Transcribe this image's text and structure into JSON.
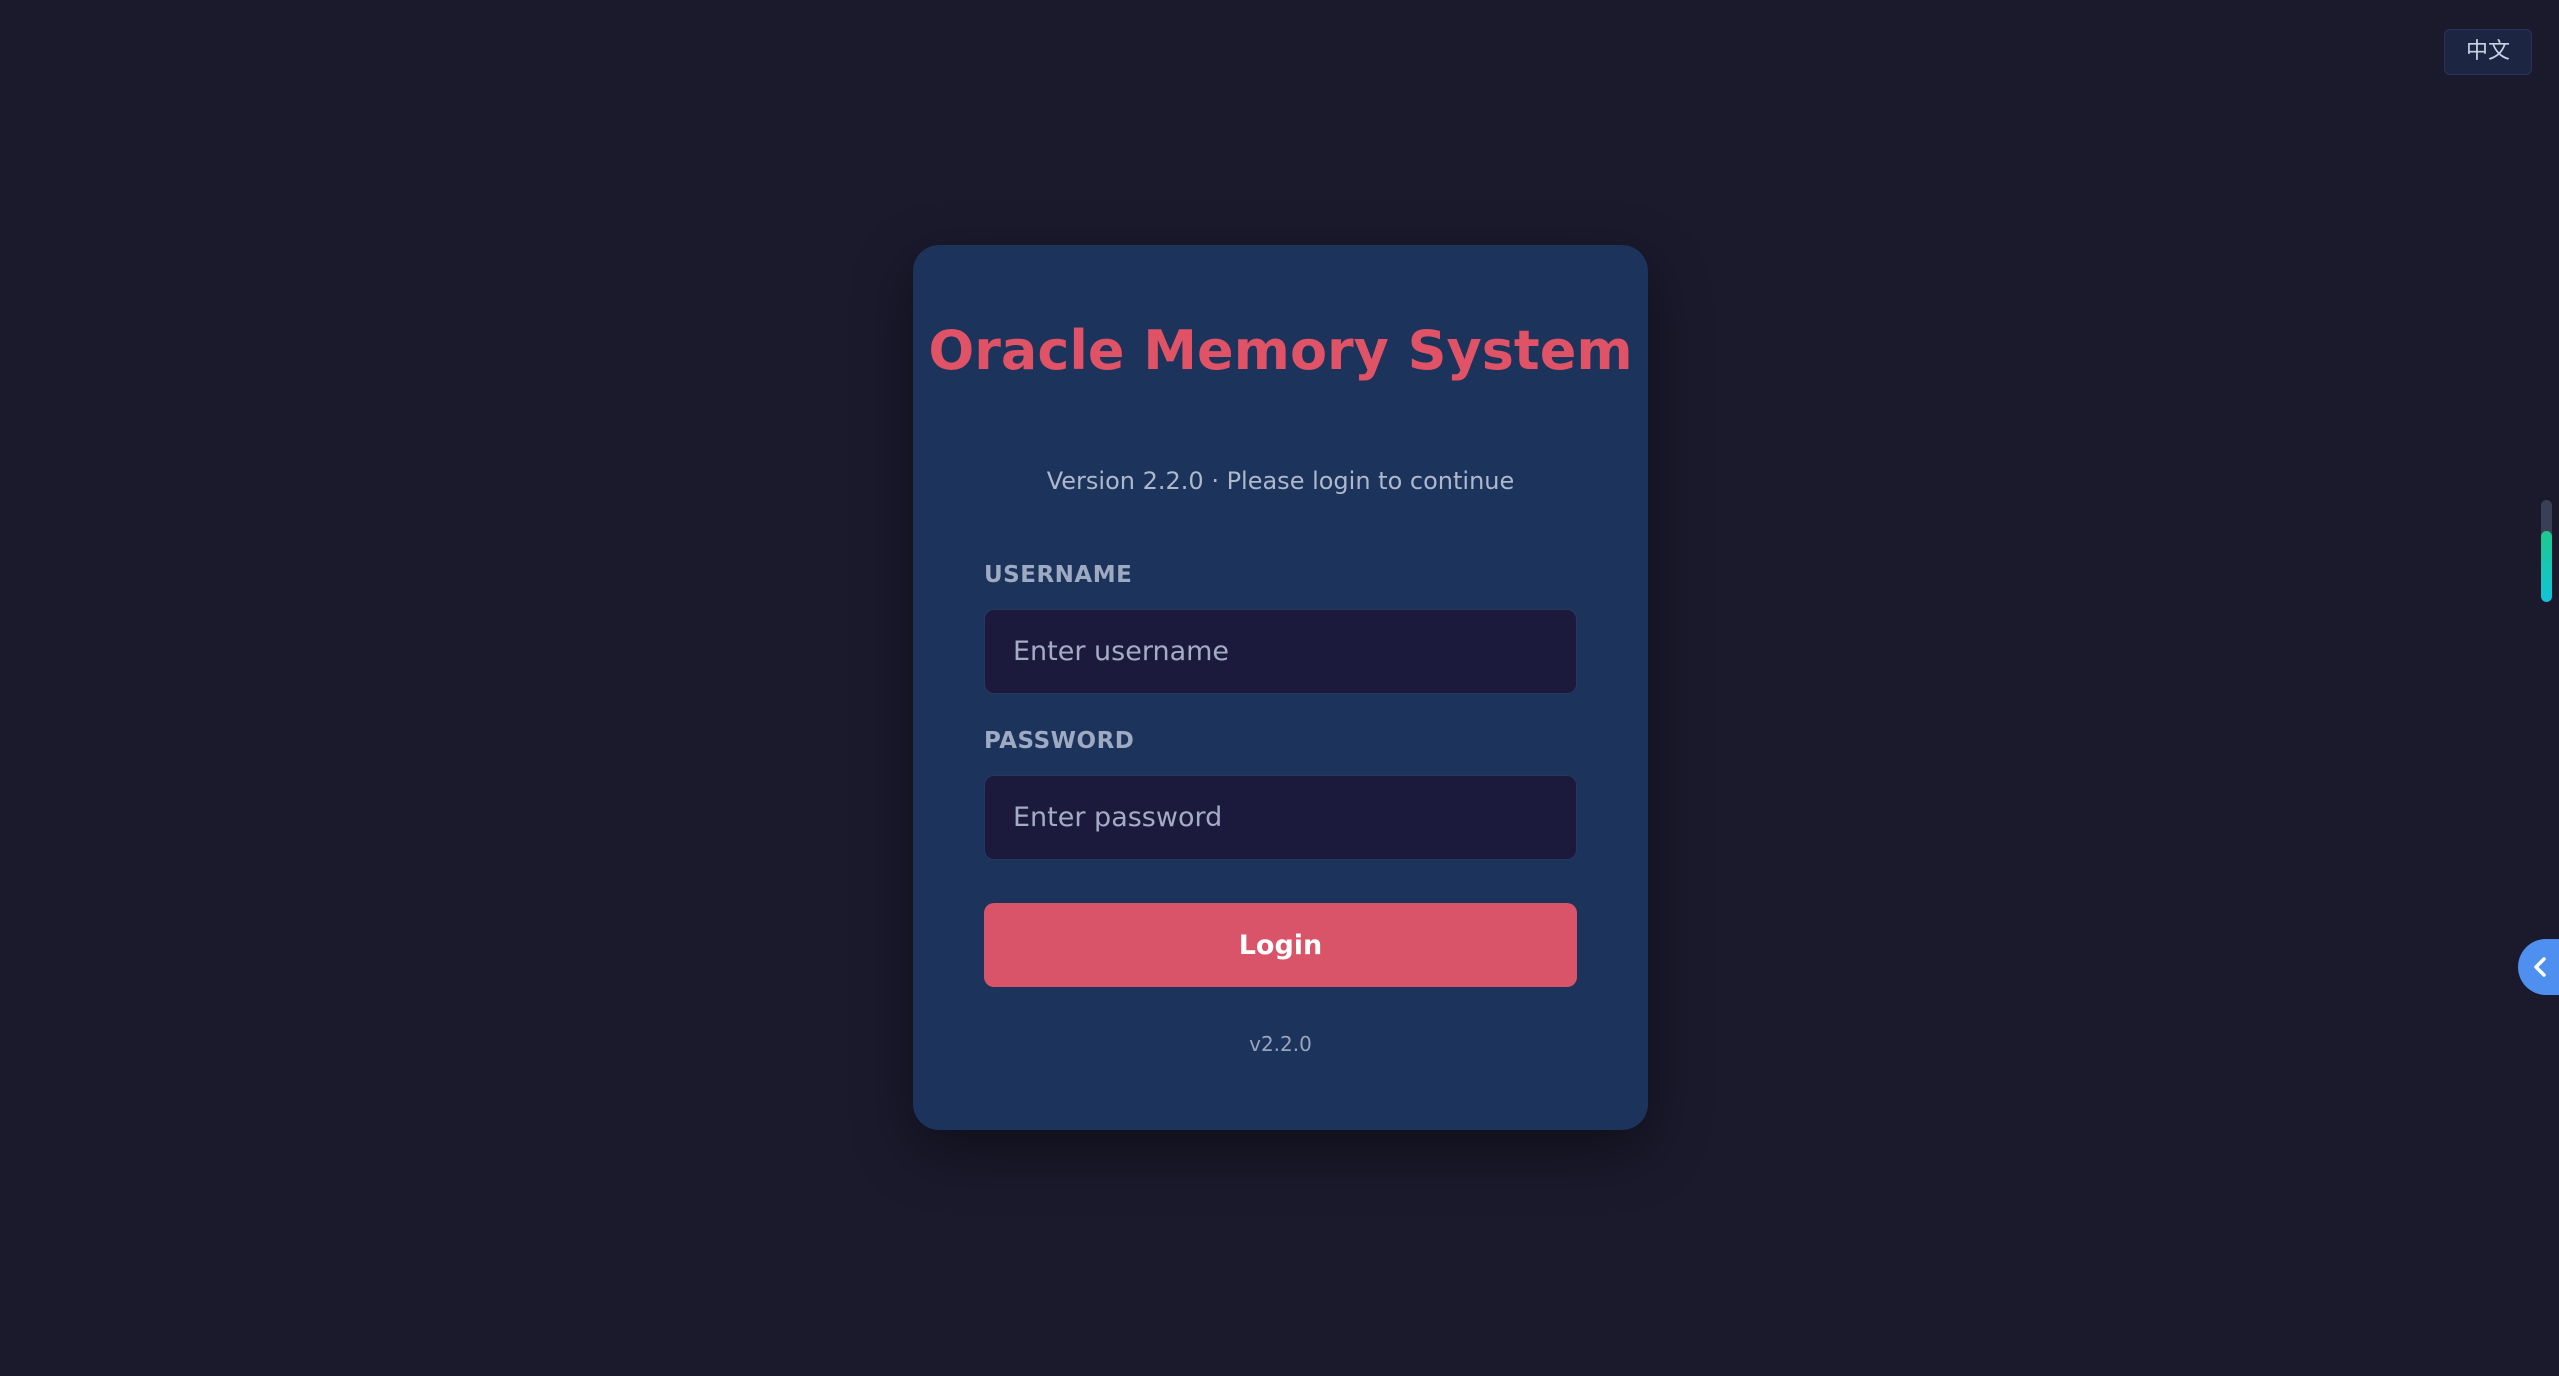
{
  "language_toggle": {
    "label": "中文"
  },
  "login_card": {
    "title": "Oracle Memory System",
    "subtitle": "Version 2.2.0 · Please login to continue",
    "username": {
      "label": "USERNAME",
      "value": "",
      "placeholder": "Enter username"
    },
    "password": {
      "label": "PASSWORD",
      "value": "",
      "placeholder": "Enter password"
    },
    "login_button": "Login",
    "version_footer": "v2.2.0"
  },
  "scroll_indicator": {
    "level_percent": 70,
    "colors": [
      "#1ec88e",
      "#10c4d9"
    ]
  },
  "side_tab": {
    "icon": "chevron-left-icon",
    "color": "#4f8ff0"
  },
  "colors": {
    "background": "#1b1a2d",
    "card": "#1c335b",
    "accent": "#e05266",
    "button": "#d95468"
  }
}
